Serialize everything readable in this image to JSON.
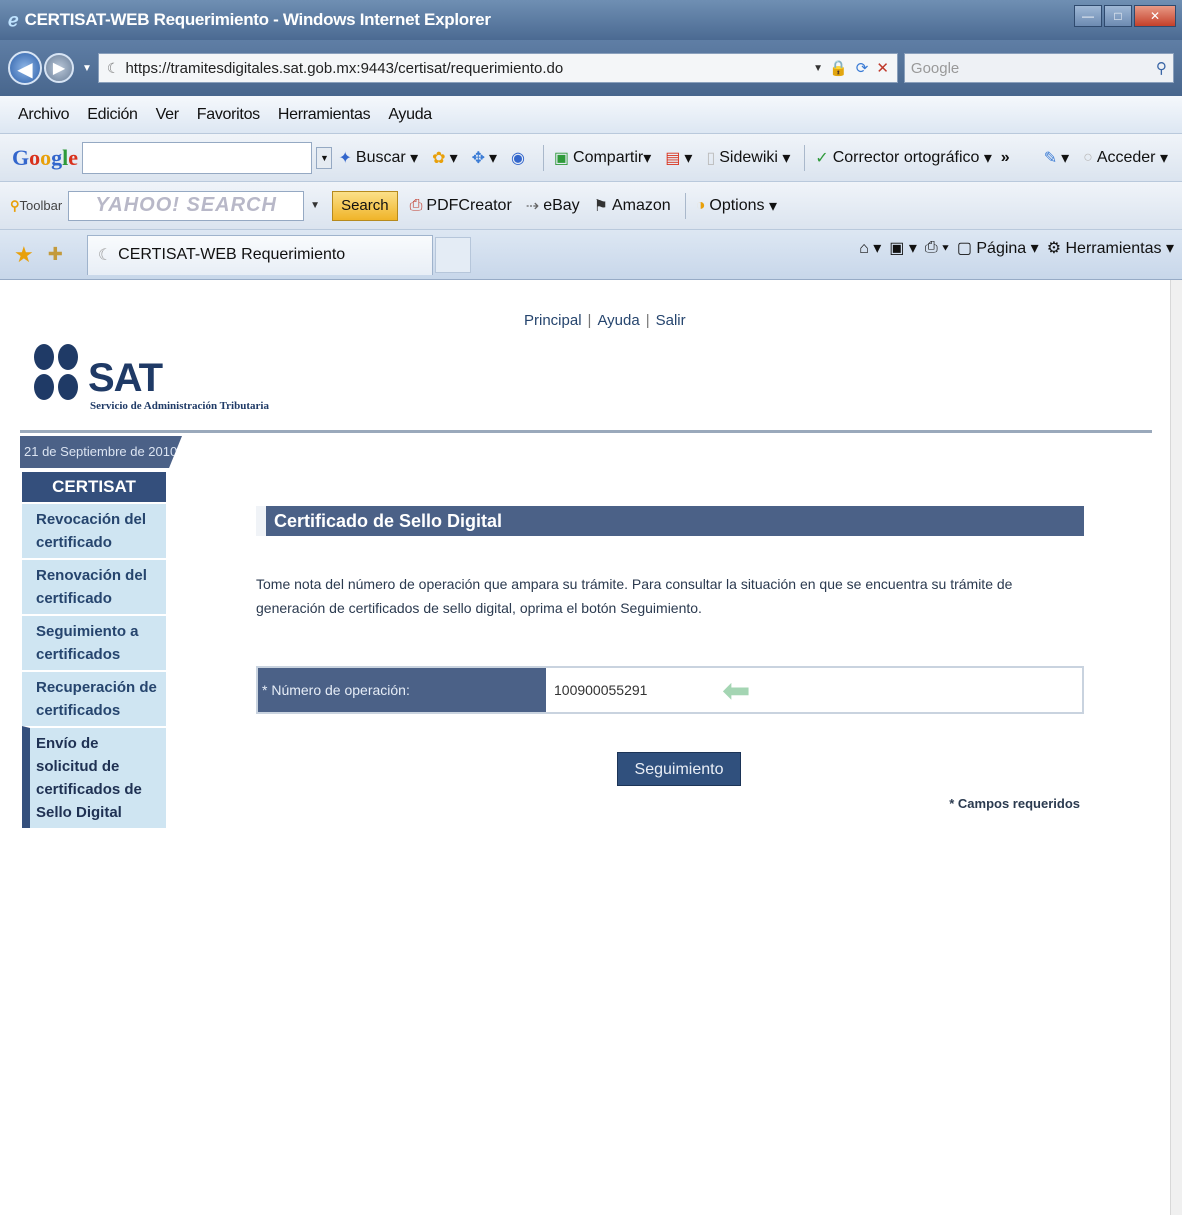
{
  "window": {
    "title": "CERTISAT-WEB Requerimiento - Windows Internet Explorer"
  },
  "address": {
    "url": "https://tramitesdigitales.sat.gob.mx:9443/certisat/requerimiento.do",
    "search_placeholder": "Google"
  },
  "menu": [
    "Archivo",
    "Edición",
    "Ver",
    "Favoritos",
    "Herramientas",
    "Ayuda"
  ],
  "google_toolbar": {
    "search_label": "Buscar",
    "share_label": "Compartir",
    "sidewiki_label": "Sidewiki",
    "spell_label": "Corrector ortográfico",
    "more_label": "»",
    "signin_label": "Acceder"
  },
  "yahoo_toolbar": {
    "brand": "Toolbar",
    "search_placeholder": "YAHOO! SEARCH",
    "search_button": "Search",
    "pdf_label": "PDFCreator",
    "ebay_label": "eBay",
    "amazon_label": "Amazon",
    "options_label": "Options"
  },
  "tab": {
    "label": "CERTISAT-WEB Requerimiento"
  },
  "command_bar": {
    "page_label": "Página",
    "tools_label": "Herramientas"
  },
  "page": {
    "links": [
      "Principal",
      "Ayuda",
      "Salir"
    ],
    "logo_text": "SAT",
    "logo_sub": "Servicio de Administración Tributaria",
    "date": "21 de Septiembre de 2010",
    "sidebar": {
      "title": "CERTISAT",
      "items": [
        "Revocación del certificado",
        "Renovación del certificado",
        "Seguimiento a certificados",
        "Recuperación de certificados",
        "Envío de solicitud de certificados de Sello Digital"
      ]
    },
    "panel_title": "Certificado de Sello Digital",
    "description": "Tome nota del número de operación que ampara su trámite. Para consultar la situación en que se encuentra su trámite de generación de certificados de sello digital, oprima el botón Seguimiento.",
    "field_label": "* Número de operación:",
    "field_value": "100900055291",
    "button_label": "Seguimiento",
    "required_note": "* Campos requeridos"
  }
}
